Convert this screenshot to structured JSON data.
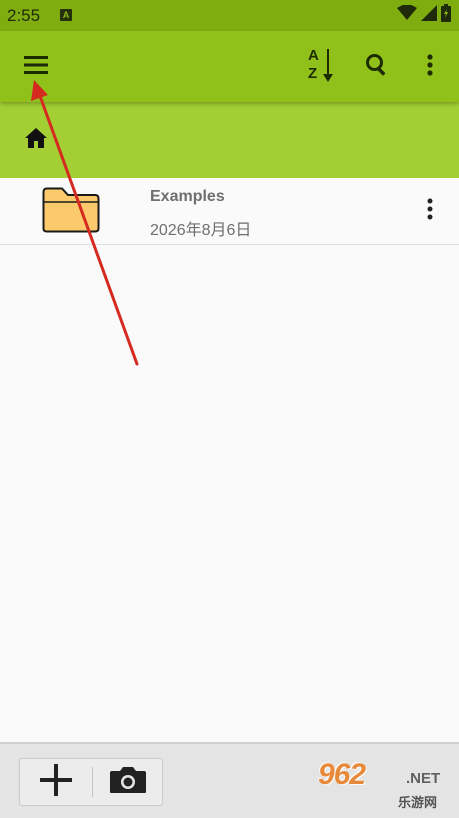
{
  "status_bar": {
    "time": "2:55",
    "notification_badge": "A",
    "icons": [
      "wifi-icon",
      "signal-icon",
      "battery-icon"
    ]
  },
  "toolbar": {
    "icons": [
      "menu-icon",
      "sort-az-icon",
      "search-icon",
      "more-vert-icon"
    ],
    "sort_letter_top": "A",
    "sort_letter_bottom": "Z"
  },
  "breadcrumb": {
    "icon": "home-icon"
  },
  "files": [
    {
      "name": "Examples",
      "date": "2026年8月6日",
      "icon": "folder-icon"
    }
  ],
  "bottom_bar": {
    "icons": [
      "add-icon",
      "camera-icon"
    ]
  },
  "watermark": {
    "logo": "962",
    "suffix": ".NET",
    "subtitle": "乐游网"
  },
  "colors": {
    "status_bar": "#7fac0e",
    "toolbar": "#8fc11a",
    "breadcrumb_bar": "#a3cf34",
    "annotation_arrow": "#d42a20",
    "folder_fill": "#fcc96c"
  }
}
